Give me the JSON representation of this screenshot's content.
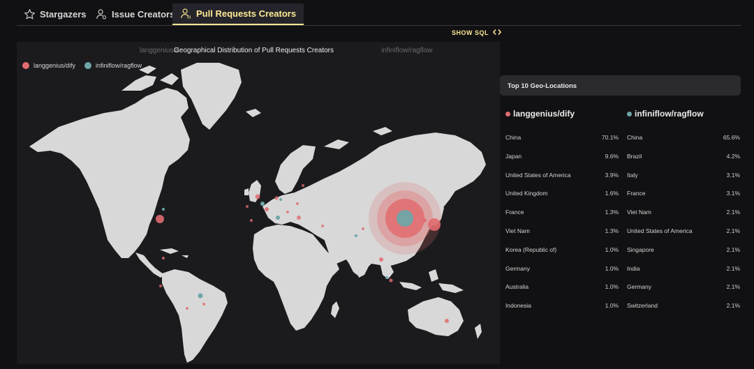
{
  "tabs": [
    {
      "label": "Stargazers",
      "icon": "star-icon"
    },
    {
      "label": "Issue Creators",
      "icon": "user-icon"
    },
    {
      "label": "Pull Requests Creators",
      "icon": "user-pr-icon",
      "active": true
    }
  ],
  "show_sql": {
    "label": "SHOW SQL",
    "icon": "code-icon"
  },
  "map": {
    "title": "Geographical Distribution of Pull Requests Creators",
    "ghost_left": "langgenius/d",
    "ghost_right": "infiniflow/ragflow",
    "legend": [
      {
        "label": "langgenius/dify",
        "color": "#e06c6e"
      },
      {
        "label": "infiniflow/ragflow",
        "color": "#5f9ea0"
      }
    ]
  },
  "colors": {
    "accent": "#ffe895",
    "dify": "#e06c6e",
    "ragflow": "#6fa6a8",
    "land": "#d8d8d8",
    "panel": "#1b1b1e"
  },
  "geo": {
    "header": "Top 10 Geo-Locations",
    "columns": [
      {
        "repo": "langgenius/dify",
        "color": "#e06c6e",
        "rows": [
          {
            "country": "China",
            "pct": "70.1%"
          },
          {
            "country": "Japan",
            "pct": "9.6%"
          },
          {
            "country": "United States of America",
            "pct": "3.9%"
          },
          {
            "country": "United Kingdom",
            "pct": "1.6%"
          },
          {
            "country": "France",
            "pct": "1.3%"
          },
          {
            "country": "Viet Nam",
            "pct": "1.3%"
          },
          {
            "country": "Korea (Republic of)",
            "pct": "1.0%"
          },
          {
            "country": "Germany",
            "pct": "1.0%"
          },
          {
            "country": "Australia",
            "pct": "1.0%"
          },
          {
            "country": "Indonesia",
            "pct": "1.0%"
          }
        ]
      },
      {
        "repo": "infiniflow/ragflow",
        "color": "#6fa6a8",
        "rows": [
          {
            "country": "China",
            "pct": "65.6%"
          },
          {
            "country": "Brazil",
            "pct": "4.2%"
          },
          {
            "country": "Italy",
            "pct": "3.1%"
          },
          {
            "country": "France",
            "pct": "3.1%"
          },
          {
            "country": "Viet Nam",
            "pct": "2.1%"
          },
          {
            "country": "United States of America",
            "pct": "2.1%"
          },
          {
            "country": "Singapore",
            "pct": "2.1%"
          },
          {
            "country": "India",
            "pct": "2.1%"
          },
          {
            "country": "Germany",
            "pct": "2.1%"
          },
          {
            "country": "Switzerland",
            "pct": "2.1%"
          }
        ]
      }
    ]
  }
}
